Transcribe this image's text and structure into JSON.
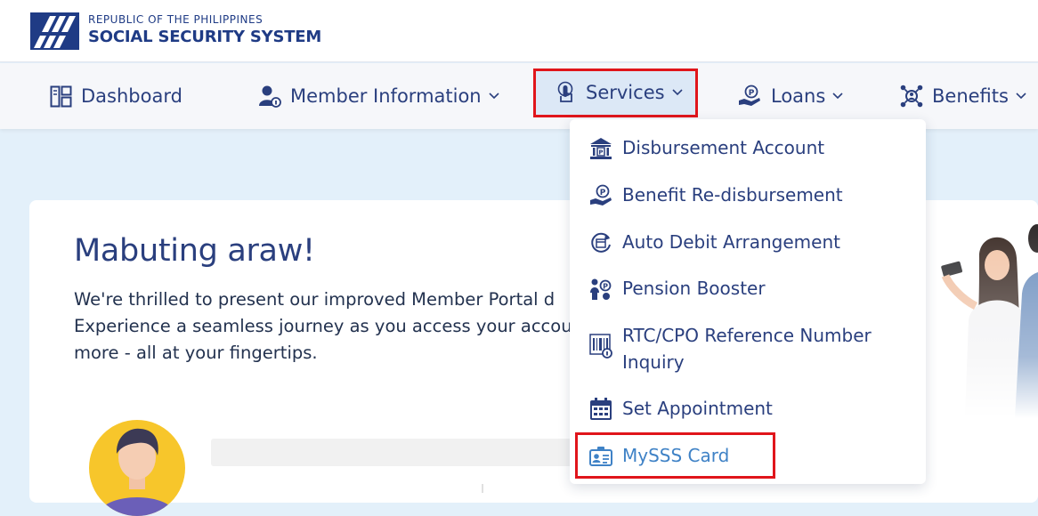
{
  "header": {
    "republic": "REPUBLIC OF THE PHILIPPINES",
    "agency": "SOCIAL SECURITY SYSTEM"
  },
  "nav": {
    "items": [
      {
        "label": "Dashboard",
        "icon": "dashboard-icon",
        "has_chevron": false
      },
      {
        "label": "Member Information",
        "icon": "member-info-icon",
        "has_chevron": true
      },
      {
        "label": "Services",
        "icon": "services-touch-icon",
        "has_chevron": true,
        "active": true
      },
      {
        "label": "Loans",
        "icon": "loans-icon",
        "has_chevron": true
      },
      {
        "label": "Benefits",
        "icon": "benefits-icon",
        "has_chevron": true
      }
    ]
  },
  "services_menu": {
    "items": [
      {
        "label": "Disbursement Account",
        "icon": "bank-icon"
      },
      {
        "label": "Benefit Re-disbursement",
        "icon": "hand-coin-icon"
      },
      {
        "label": "Auto Debit Arrangement",
        "icon": "auto-debit-icon"
      },
      {
        "label": "Pension Booster",
        "icon": "pension-booster-icon"
      },
      {
        "label": "RTC/CPO Reference Number Inquiry",
        "icon": "barcode-icon"
      },
      {
        "label": "Set Appointment",
        "icon": "calendar-icon"
      },
      {
        "label": "MySSS Card",
        "icon": "id-card-icon",
        "highlighted": true
      }
    ]
  },
  "main": {
    "greeting": "Mabuting araw!",
    "intro_lines": [
      "We're thrilled to present our improved Member Portal d",
      "Experience a seamless journey as you access your accou",
      "more - all at your fingertips."
    ]
  },
  "colors": {
    "brand": "#1f3b85",
    "text": "#2a3f7e",
    "highlight_border": "#e0151b",
    "page_bg": "#e3f0fa",
    "link": "#3f82c6"
  }
}
